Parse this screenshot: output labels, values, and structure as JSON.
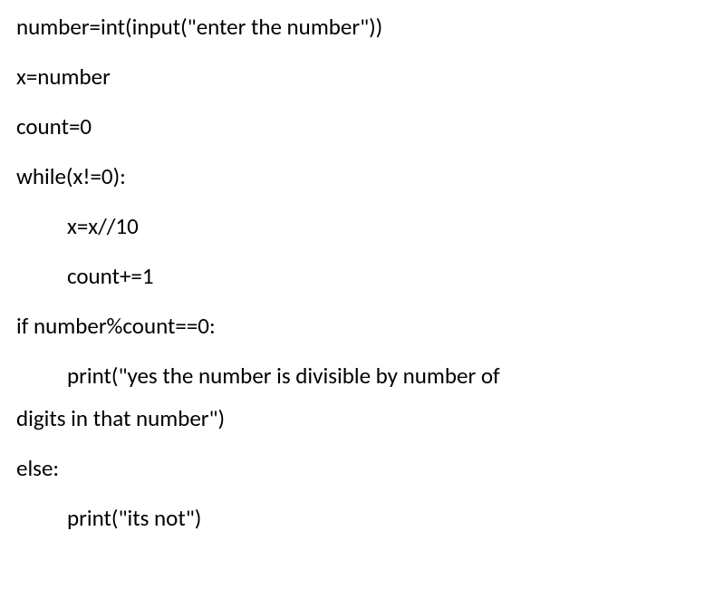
{
  "code": {
    "line1": "number=int(input(\"enter the number\"))",
    "line2": "x=number",
    "line3": "count=0",
    "line4": "while(x!=0):",
    "line5": "x=x//10",
    "line6": "count+=1",
    "line7": "if number%count==0:",
    "line8": "print(\"yes the number is divisible by number of",
    "line8b": "digits in that number\")",
    "line9": "else:",
    "line10": "print(\"its not\")"
  }
}
